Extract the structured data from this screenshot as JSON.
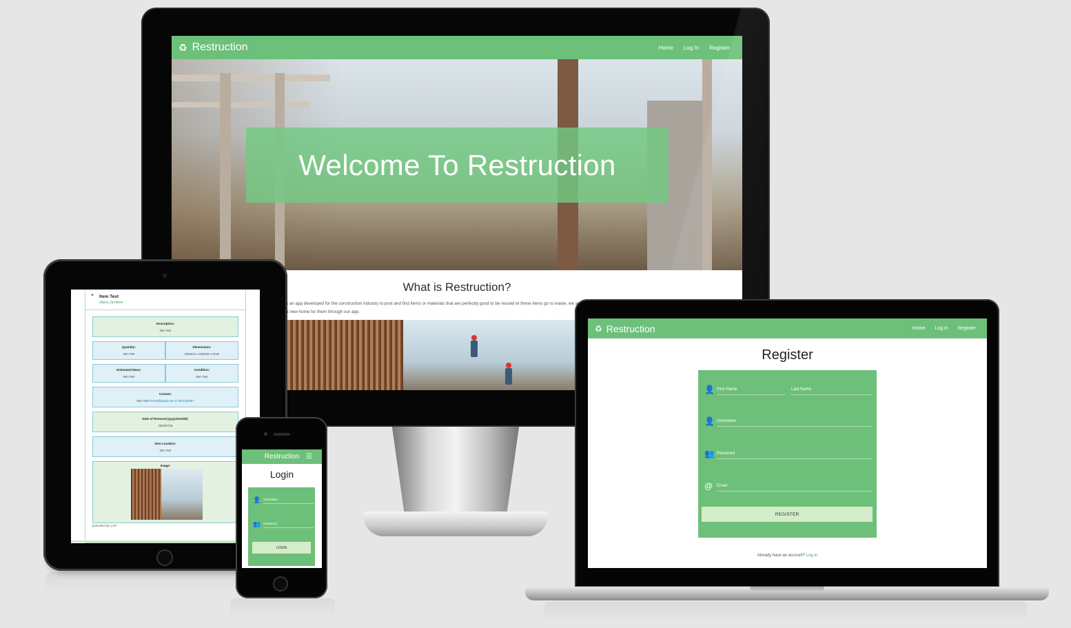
{
  "brand": "Restruction",
  "nav": {
    "home": "Home",
    "login": "Log In",
    "register": "Register"
  },
  "icons": {
    "brand": "recycle-icon",
    "user": "user-icon",
    "user_plus": "user-plus-icon",
    "user_lock": "user-lock-icon",
    "at": "at-icon",
    "menu": "menu-icon"
  },
  "colors": {
    "primary": "#6dc07a",
    "button": "#d5ecc9",
    "overlay": "#73c982"
  },
  "desktop": {
    "hero_title": "Welcome To Restruction",
    "what_title": "What is Restruction?",
    "what_text": "s an app developed for the construction industry to post and find items or materials that are perfectly good to be reused et these items go to waste, we aim on finding a new home for them through our app."
  },
  "laptop": {
    "title": "Register",
    "fields": {
      "first_name": "First Name",
      "last_name": "Last Name",
      "username": "Username",
      "password": "Password",
      "email": "Email"
    },
    "button": "REGISTER",
    "already_text": "Already have an account?",
    "login_link": "Log in"
  },
  "tablet": {
    "item_title": "Item Test",
    "item_category": "object_furniture",
    "description_label": "Description:",
    "description_value": "Item Test",
    "quantity_label": "Quantity:",
    "quantity_value": "Item Test",
    "dimensions_label": "Dimensions:",
    "dimensions_value": "1000mm x 1000mm x 5mm",
    "mass_label": "Estimated Mass:",
    "mass_value": "Item Test",
    "condition_label": "Condition:",
    "condition_value": "Item Test",
    "contact_label": "Contact:",
    "contact_name": "Item Test",
    "contact_email": "item@gmail.com",
    "contact_phone": "0871234567",
    "removal_label": "Date of Removal (yyyy/mm/dd):",
    "removal_value": "2022/07/15",
    "location_label": "Item Location:",
    "location_value": "Item Test",
    "image_label": "Image:",
    "uploaded_by": "Uploaded By: josh"
  },
  "phone": {
    "title": "Login",
    "username": "Username",
    "password": "Password",
    "button": "LOGIN"
  }
}
